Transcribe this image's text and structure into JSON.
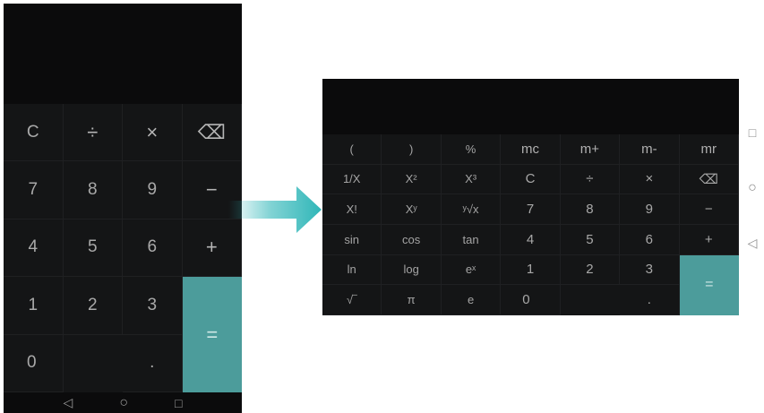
{
  "portrait": {
    "keys": [
      {
        "label": "C",
        "cls": "pk"
      },
      {
        "label": "÷",
        "cls": "pk op"
      },
      {
        "label": "×",
        "cls": "pk op"
      },
      {
        "label": "⌫",
        "cls": "pk op",
        "name": "backspace"
      },
      {
        "label": "7",
        "cls": "pk"
      },
      {
        "label": "8",
        "cls": "pk"
      },
      {
        "label": "9",
        "cls": "pk"
      },
      {
        "label": "−",
        "cls": "pk op"
      },
      {
        "label": "4",
        "cls": "pk"
      },
      {
        "label": "5",
        "cls": "pk"
      },
      {
        "label": "6",
        "cls": "pk"
      },
      {
        "label": "+",
        "cls": "pk op"
      },
      {
        "label": "1",
        "cls": "pk"
      },
      {
        "label": "2",
        "cls": "pk"
      },
      {
        "label": "3",
        "cls": "pk"
      },
      {
        "label": "=",
        "cls": "pk eq"
      },
      {
        "label": "0",
        "cls": "pk z"
      },
      {
        "label": ".",
        "cls": "pk dot"
      }
    ],
    "nav": {
      "back": "◁",
      "home": "○",
      "recents": "□"
    }
  },
  "landscape": {
    "keys": [
      {
        "label": "(",
        "cls": "lk"
      },
      {
        "label": ")",
        "cls": "lk"
      },
      {
        "label": "%",
        "cls": "lk"
      },
      {
        "label": "mc",
        "cls": "lk mem"
      },
      {
        "label": "m+",
        "cls": "lk mem"
      },
      {
        "label": "m-",
        "cls": "lk mem"
      },
      {
        "label": "mr",
        "cls": "lk mem"
      },
      {
        "label": "1/X",
        "cls": "lk"
      },
      {
        "label": "X²",
        "cls": "lk"
      },
      {
        "label": "X³",
        "cls": "lk"
      },
      {
        "label": "C",
        "cls": "lk num"
      },
      {
        "label": "÷",
        "cls": "lk num"
      },
      {
        "label": "×",
        "cls": "lk num"
      },
      {
        "label": "⌫",
        "cls": "lk num",
        "name": "backspace"
      },
      {
        "label": "X!",
        "cls": "lk"
      },
      {
        "label": "Xʸ",
        "cls": "lk"
      },
      {
        "label": "ʸ√x",
        "cls": "lk"
      },
      {
        "label": "7",
        "cls": "lk num"
      },
      {
        "label": "8",
        "cls": "lk num"
      },
      {
        "label": "9",
        "cls": "lk num"
      },
      {
        "label": "−",
        "cls": "lk num"
      },
      {
        "label": "sin",
        "cls": "lk"
      },
      {
        "label": "cos",
        "cls": "lk"
      },
      {
        "label": "tan",
        "cls": "lk"
      },
      {
        "label": "4",
        "cls": "lk num"
      },
      {
        "label": "5",
        "cls": "lk num"
      },
      {
        "label": "6",
        "cls": "lk num"
      },
      {
        "label": "+",
        "cls": "lk num"
      },
      {
        "label": "ln",
        "cls": "lk"
      },
      {
        "label": "log",
        "cls": "lk"
      },
      {
        "label": "eˣ",
        "cls": "lk"
      },
      {
        "label": "1",
        "cls": "lk num"
      },
      {
        "label": "2",
        "cls": "lk num"
      },
      {
        "label": "3",
        "cls": "lk num"
      },
      {
        "label": "=",
        "cls": "lk eq"
      },
      {
        "label": "√‾",
        "cls": "lk"
      },
      {
        "label": "π",
        "cls": "lk"
      },
      {
        "label": "e",
        "cls": "lk"
      },
      {
        "label": "0",
        "cls": "lk num z"
      },
      {
        "label": ".",
        "cls": "lk num dot"
      }
    ],
    "nav": {
      "recents": "□",
      "home": "○",
      "back": "◁"
    }
  },
  "colors": {
    "accent": "#4c9c9b",
    "keypad": "#141516",
    "display": "#0b0b0c",
    "arrow": "#2fb6b8"
  }
}
